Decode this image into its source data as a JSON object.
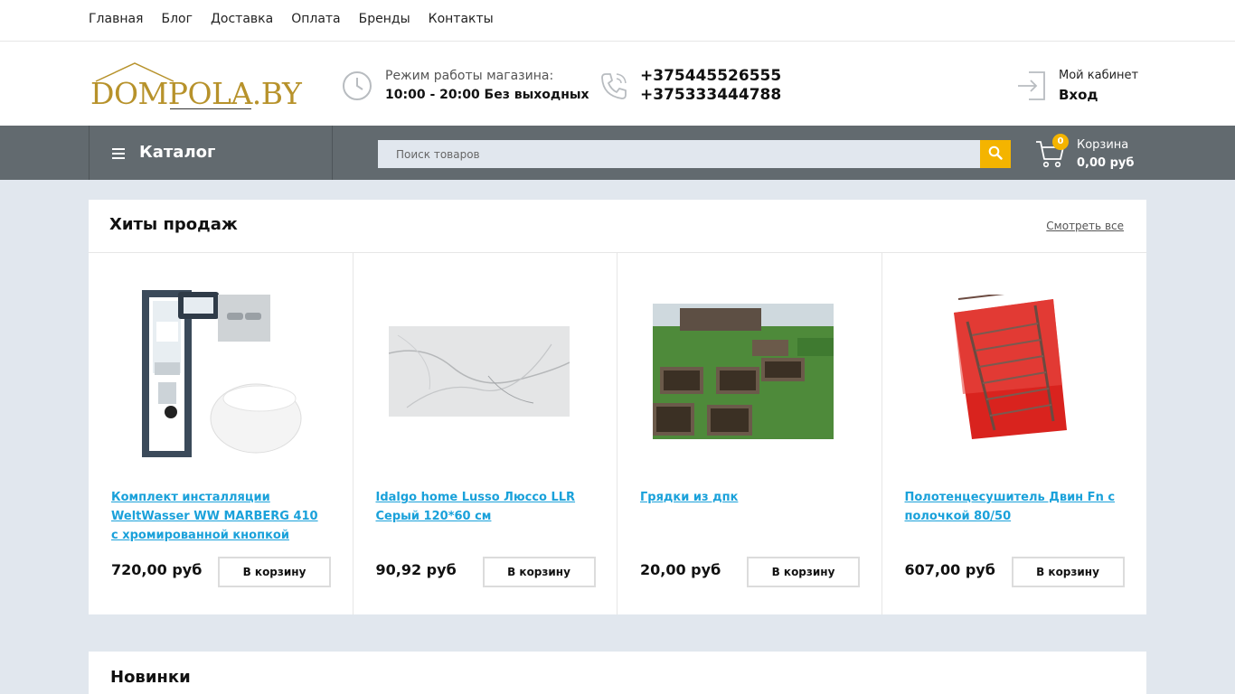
{
  "topnav": [
    "Главная",
    "Блог",
    "Доставка",
    "Оплата",
    "Бренды",
    "Контакты"
  ],
  "logo": {
    "text": "DOMPOLA.BY"
  },
  "hours": {
    "label": "Режим работы магазина:",
    "value": "10:00 - 20:00 Без выходных"
  },
  "phones": [
    "+375445526555",
    "+375333444788"
  ],
  "cabinet": {
    "label": "Мой кабинет",
    "login": "Вход"
  },
  "catalog": {
    "label": "Каталог"
  },
  "search": {
    "placeholder": "Поиск товаров"
  },
  "cart": {
    "count": "0",
    "label": "Корзина",
    "total": "0,00 руб"
  },
  "hits": {
    "title": "Хиты продаж",
    "see_all": "Смотреть все",
    "products": [
      {
        "name": "Комплект инсталляции WeltWasser WW MARBERG 410 с хромированной кнопкой",
        "price": "720,00 руб",
        "buy": "В корзину"
      },
      {
        "name": "Idalgo home Lusso Люссо LLR Серый 120*60 см",
        "price": "90,92 руб",
        "buy": "В корзину"
      },
      {
        "name": "Грядки из дпк",
        "price": "20,00 руб",
        "buy": "В корзину"
      },
      {
        "name": "Полотенцесушитель Двин Fn с полочкой 80/50",
        "price": "607,00 руб",
        "buy": "В корзину"
      }
    ]
  },
  "news": {
    "title": "Новинки"
  },
  "colors": {
    "accent": "#f4b400",
    "link": "#1aa1da",
    "bar": "#626a6f",
    "logo": "#b7922b"
  }
}
